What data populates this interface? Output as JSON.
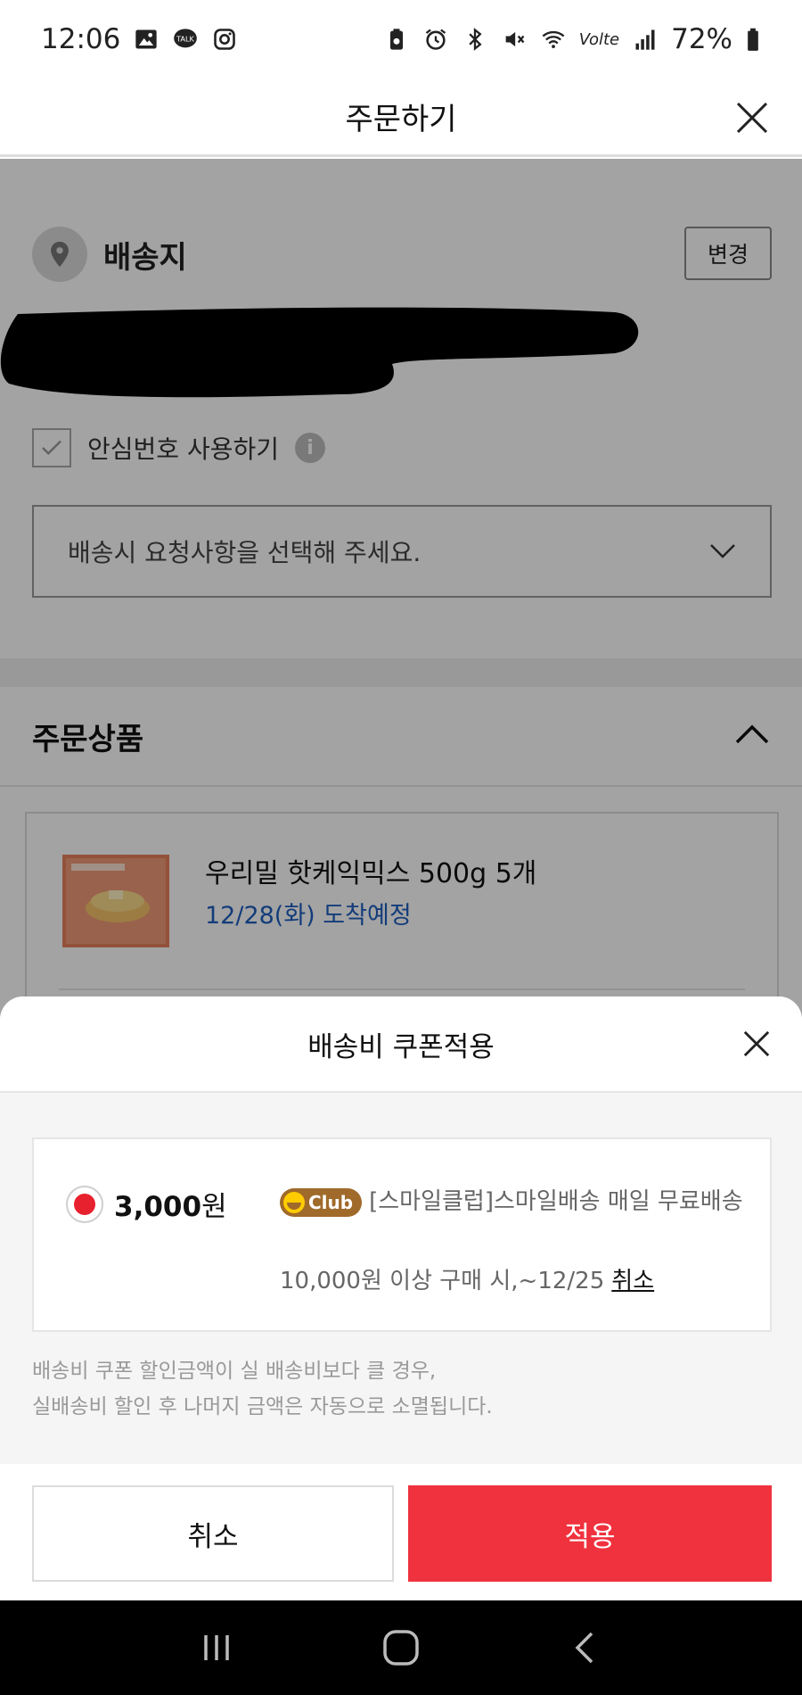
{
  "status_bar": {
    "time": "12:06",
    "talk_badge": "TALK",
    "battery_percent": "72%",
    "volte_label": "Volte"
  },
  "header": {
    "title": "주문하기"
  },
  "address": {
    "title": "배송지",
    "change_label": "변경",
    "safe_number_label": "안심번호 사용하기",
    "request_placeholder": "배송시 요청사항을 선택해 주세요."
  },
  "order": {
    "title": "주문상품",
    "product_name": "우리밀 핫케익믹스 500g 5개",
    "delivery_date": "12/28(화) 도착예정"
  },
  "sheet": {
    "title": "배송비 쿠폰적용",
    "coupon": {
      "amount_number": "3,000",
      "amount_unit": "원",
      "badge": "Club",
      "description": "[스마일클럽]스마일배송 매일 무료배송",
      "condition": "10,000원 이상 구매 시,~12/25",
      "cancel_label": "취소"
    },
    "note_line1": "배송비 쿠폰 할인금액이 실 배송비보다 클 경우,",
    "note_line2": "실배송비 할인 후 나머지 금액은 자동으로 소멸됩니다.",
    "cancel_button": "취소",
    "apply_button": "적용"
  },
  "colors": {
    "accent_red": "#f0323e",
    "link_blue": "#1f5fbf",
    "club_brown": "#a06a2a"
  }
}
